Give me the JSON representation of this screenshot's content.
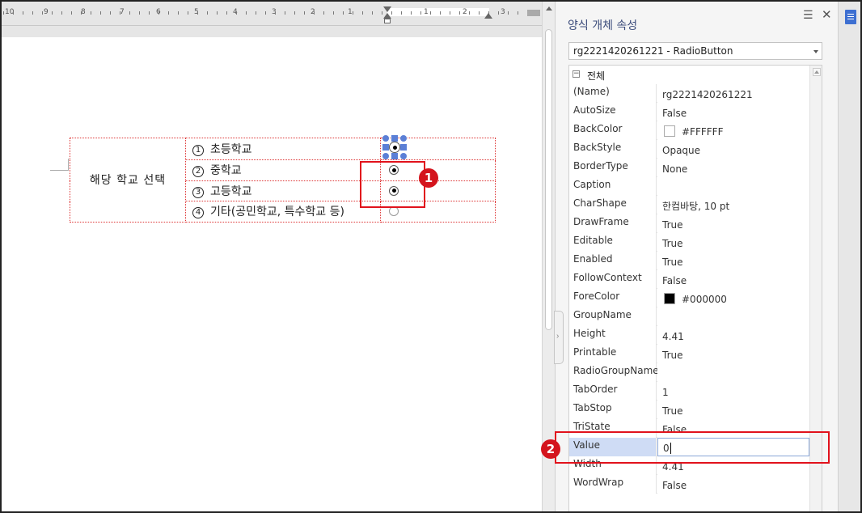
{
  "ruler": {
    "numbers": [
      "10",
      "9",
      "8",
      "7",
      "6",
      "5",
      "4",
      "3",
      "2",
      "1",
      "1",
      "2",
      "3"
    ]
  },
  "document": {
    "category_label": "해당 학교 선택",
    "options": [
      {
        "num": "1",
        "label": "초등학교",
        "state": "selected-object"
      },
      {
        "num": "2",
        "label": "중학교",
        "state": "checked"
      },
      {
        "num": "3",
        "label": "고등학교",
        "state": "checked"
      },
      {
        "num": "4",
        "label": "기타(공민학교, 특수학교 등)",
        "state": "unchecked"
      }
    ]
  },
  "annotations": {
    "badge_1": "1",
    "badge_2": "2"
  },
  "panel": {
    "title": "양식 개체 속성",
    "menu_icon": "menu-icon",
    "close_icon": "close-icon",
    "object_select": "rg2221420261221 - RadioButton",
    "group_header": "전체",
    "toggle": "−",
    "properties": [
      {
        "name": "(Name)",
        "value": "rg2221420261221"
      },
      {
        "name": "AutoSize",
        "value": "False"
      },
      {
        "name": "BackColor",
        "value": "#FFFFFF",
        "swatch": "#FFFFFF"
      },
      {
        "name": "BackStyle",
        "value": "Opaque"
      },
      {
        "name": "BorderType",
        "value": "None"
      },
      {
        "name": "Caption",
        "value": ""
      },
      {
        "name": "CharShape",
        "value": "한컴바탕, 10 pt"
      },
      {
        "name": "DrawFrame",
        "value": "True"
      },
      {
        "name": "Editable",
        "value": "True"
      },
      {
        "name": "Enabled",
        "value": "True"
      },
      {
        "name": "FollowContext",
        "value": "False"
      },
      {
        "name": "ForeColor",
        "value": "#000000",
        "swatch": "#000000"
      },
      {
        "name": "GroupName",
        "value": ""
      },
      {
        "name": "Height",
        "value": "4.41"
      },
      {
        "name": "Printable",
        "value": "True"
      },
      {
        "name": "RadioGroupName",
        "value": ""
      },
      {
        "name": "TabOrder",
        "value": "1"
      },
      {
        "name": "TabStop",
        "value": "True"
      },
      {
        "name": "TriState",
        "value": "False"
      },
      {
        "name": "Value",
        "value": "0",
        "editing": true
      },
      {
        "name": "Width",
        "value": "4.41"
      },
      {
        "name": "WordWrap",
        "value": "False"
      }
    ]
  },
  "colors": {
    "accent": "#5b7fd6",
    "annotation": "#e1121c",
    "selected_row": "#cfdcf5"
  }
}
